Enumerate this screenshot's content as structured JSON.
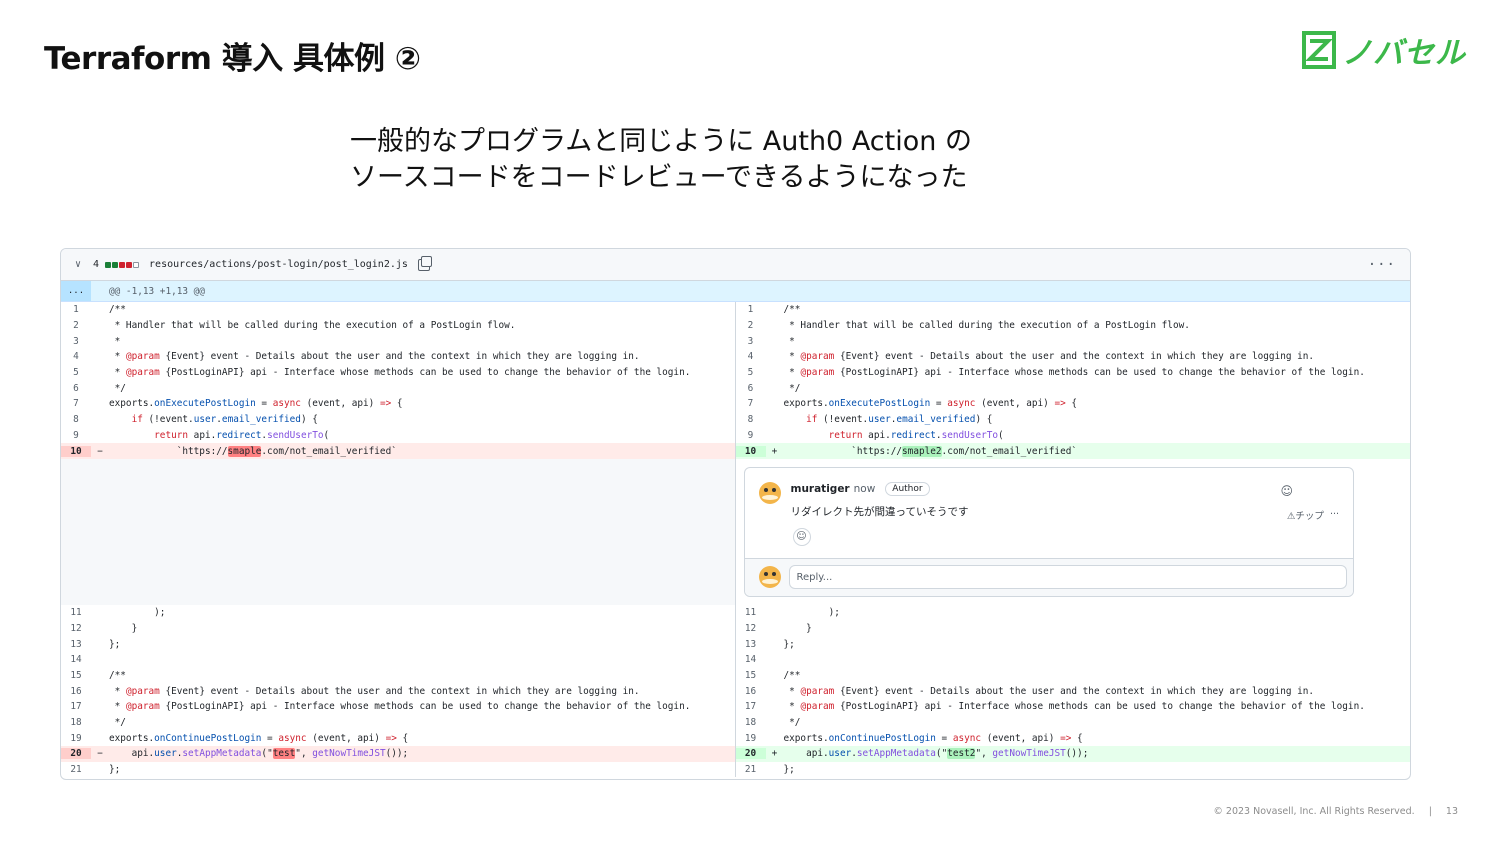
{
  "slide": {
    "title": "Terraform 導入 具体例 ②",
    "logo_text": "ノバセル",
    "subtitle_line1": "一般的なプログラムと同じように Auth0 Action の",
    "subtitle_line2": "ソースコードをコードレビューできるようになった",
    "footer_copyright": "© 2023 Novasell, Inc. All Rights Reserved.",
    "footer_sep": "|",
    "page_number": "13",
    "brand_color": "#3cb84a"
  },
  "diff": {
    "changes_count": "4",
    "file_path": "resources/actions/post-login/post_login2.js",
    "kebab": "···",
    "hunk_expand": "...",
    "hunk_header": "@@ -1,13 +1,13 @@",
    "left_top": [
      {
        "n": "1",
        "s": "",
        "t": "/**",
        "k": ""
      },
      {
        "n": "2",
        "s": "",
        "t": " * Handler that will be called during the execution of a PostLogin flow.",
        "k": ""
      },
      {
        "n": "3",
        "s": "",
        "t": " *",
        "k": ""
      },
      {
        "n": "4",
        "s": "",
        "t": " * @param {Event} event - Details about the user and the context in which they are logging in.",
        "k": ""
      },
      {
        "n": "5",
        "s": "",
        "t": " * @param {PostLoginAPI} api - Interface whose methods can be used to change the behavior of the login.",
        "k": ""
      },
      {
        "n": "6",
        "s": "",
        "t": " */",
        "k": ""
      },
      {
        "n": "7",
        "s": "",
        "t": "exports.onExecutePostLogin = async (event, api) => {",
        "k": ""
      },
      {
        "n": "8",
        "s": "",
        "t": "    if (!event.user.email_verified) {",
        "k": ""
      },
      {
        "n": "9",
        "s": "",
        "t": "        return api.redirect.sendUserTo(",
        "k": ""
      },
      {
        "n": "10",
        "s": "−",
        "t": "            `https://smaple.com/not_email_verified`",
        "k": "del"
      }
    ],
    "right_top": [
      {
        "n": "1",
        "s": "",
        "t": "/**",
        "k": ""
      },
      {
        "n": "2",
        "s": "",
        "t": " * Handler that will be called during the execution of a PostLogin flow.",
        "k": ""
      },
      {
        "n": "3",
        "s": "",
        "t": " *",
        "k": ""
      },
      {
        "n": "4",
        "s": "",
        "t": " * @param {Event} event - Details about the user and the context in which they are logging in.",
        "k": ""
      },
      {
        "n": "5",
        "s": "",
        "t": " * @param {PostLoginAPI} api - Interface whose methods can be used to change the behavior of the login.",
        "k": ""
      },
      {
        "n": "6",
        "s": "",
        "t": " */",
        "k": ""
      },
      {
        "n": "7",
        "s": "",
        "t": "exports.onExecutePostLogin = async (event, api) => {",
        "k": ""
      },
      {
        "n": "8",
        "s": "",
        "t": "    if (!event.user.email_verified) {",
        "k": ""
      },
      {
        "n": "9",
        "s": "",
        "t": "        return api.redirect.sendUserTo(",
        "k": ""
      },
      {
        "n": "10",
        "s": "+",
        "t": "            `https://smaple2.com/not_email_verified`",
        "k": "add"
      }
    ],
    "left_bottom": [
      {
        "n": "11",
        "s": "",
        "t": "        );",
        "k": ""
      },
      {
        "n": "12",
        "s": "",
        "t": "    }",
        "k": ""
      },
      {
        "n": "13",
        "s": "",
        "t": "};",
        "k": ""
      },
      {
        "n": "14",
        "s": "",
        "t": "",
        "k": ""
      },
      {
        "n": "15",
        "s": "",
        "t": "/**",
        "k": ""
      },
      {
        "n": "16",
        "s": "",
        "t": " * @param {Event} event - Details about the user and the context in which they are logging in.",
        "k": ""
      },
      {
        "n": "17",
        "s": "",
        "t": " * @param {PostLoginAPI} api - Interface whose methods can be used to change the behavior of the login.",
        "k": ""
      },
      {
        "n": "18",
        "s": "",
        "t": " */",
        "k": ""
      },
      {
        "n": "19",
        "s": "",
        "t": "exports.onContinuePostLogin = async (event, api) => {",
        "k": ""
      },
      {
        "n": "20",
        "s": "−",
        "t": "    api.user.setAppMetadata(\"test\", getNowTimeJST());",
        "k": "del"
      },
      {
        "n": "21",
        "s": "",
        "t": "};",
        "k": ""
      }
    ],
    "right_bottom": [
      {
        "n": "11",
        "s": "",
        "t": "        );",
        "k": ""
      },
      {
        "n": "12",
        "s": "",
        "t": "    }",
        "k": ""
      },
      {
        "n": "13",
        "s": "",
        "t": "};",
        "k": ""
      },
      {
        "n": "14",
        "s": "",
        "t": "",
        "k": ""
      },
      {
        "n": "15",
        "s": "",
        "t": "/**",
        "k": ""
      },
      {
        "n": "16",
        "s": "",
        "t": " * @param {Event} event - Details about the user and the context in which they are logging in.",
        "k": ""
      },
      {
        "n": "17",
        "s": "",
        "t": " * @param {PostLoginAPI} api - Interface whose methods can be used to change the behavior of the login.",
        "k": ""
      },
      {
        "n": "18",
        "s": "",
        "t": " */",
        "k": ""
      },
      {
        "n": "19",
        "s": "",
        "t": "exports.onContinuePostLogin = async (event, api) => {",
        "k": ""
      },
      {
        "n": "20",
        "s": "+",
        "t": "    api.user.setAppMetadata(\"test2\", getNowTimeJST());",
        "k": "add"
      },
      {
        "n": "21",
        "s": "",
        "t": "};",
        "k": ""
      }
    ]
  },
  "comment": {
    "user": "muratiger",
    "time": "now",
    "badge": "Author",
    "body": "リダイレクト先が間違っていそうです",
    "tip_label": "チップ",
    "tip_icon": "warning-icon",
    "more": "···",
    "reply_placeholder": "Reply..."
  }
}
